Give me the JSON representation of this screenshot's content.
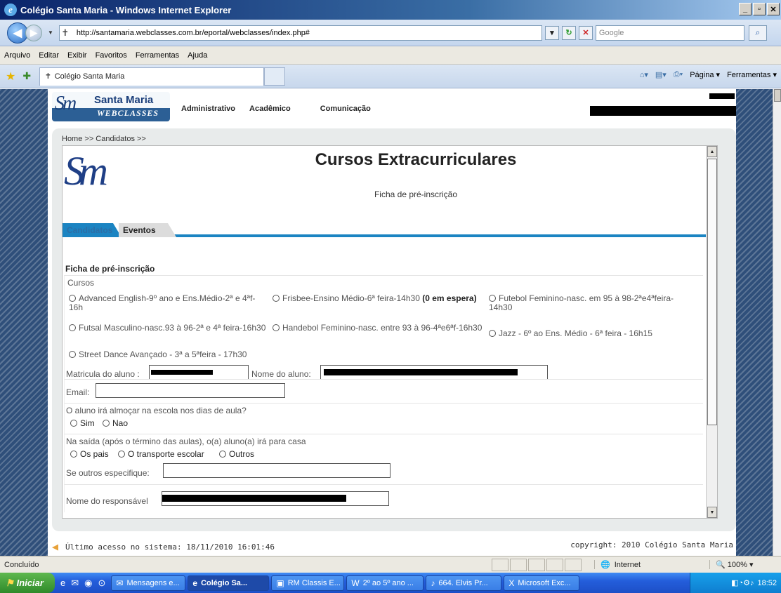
{
  "window": {
    "title": "Colégio Santa Maria - Windows Internet Explorer",
    "url": "http://santamaria.webclasses.com.br/eportal/webclasses/index.php#",
    "search_placeholder": "Google"
  },
  "menu": [
    "Arquivo",
    "Editar",
    "Exibir",
    "Favoritos",
    "Ferramentas",
    "Ajuda"
  ],
  "browser_tab": {
    "label": "Colégio Santa Maria"
  },
  "command_bar": {
    "page": "Página ▾",
    "tools": "Ferramentas ▾"
  },
  "site": {
    "logo_name": "Santa Maria",
    "logo_web": "WEBCLASSES",
    "nav": [
      "Administrativo",
      "Acadêmico",
      "Comunicação"
    ],
    "breadcrumb": "Home >> Candidatos >>",
    "title": "Cursos Extracurriculares",
    "subtitle": "Ficha de pré-inscrição",
    "tabs": [
      "Candidatos",
      "Eventos"
    ]
  },
  "form": {
    "heading": "Ficha de pré-inscrição",
    "courses_label": "Cursos",
    "courses": [
      "Advanced English-9º ano e Ens.Médio-2ª e 4ªf-16h",
      "Frisbee-Ensino Médio-6ª feira-14h30",
      "Futebol Feminino-nasc. em 95 à 98-2ªe4ªfeira-14h30",
      "Futsal Masculino-nasc.93 à 96-2ª e 4ª feira-16h30",
      "Handebol Feminino-nasc. entre 93 à 96-4ªe6ªf-16h30",
      "Jazz - 6º ao Ens. Médio - 6ª feira - 16h15",
      "Street Dance Avançado - 3ª a 5ªfeira - 17h30"
    ],
    "frisbee_note": "(0 em espera)",
    "matricula_label": "Matricula do aluno :",
    "nome_label": "Nome do aluno:",
    "email_label": "Email:",
    "lunch_question": "O aluno irá almoçar na escola nos dias de aula?",
    "lunch_options": [
      "Sim",
      "Nao"
    ],
    "exit_question": "Na saída (após o término das aulas), o(a) aluno(a) irá para casa",
    "exit_options": [
      "Os pais",
      "O transporte escolar",
      "Outros"
    ],
    "other_label": "Se outros especifique:",
    "guardian_label": "Nome do responsável"
  },
  "footer": {
    "last_access": "Último acesso no sistema: 18/11/2010 16:01:46",
    "copyright": "copyright: 2010 Colégio Santa Maria"
  },
  "status": {
    "text": "Concluído",
    "zone": "Internet",
    "zoom": "100%"
  },
  "taskbar": {
    "start": "Iniciar",
    "tasks": [
      "Mensagens e...",
      "Colégio Sa...",
      "RM Classis E...",
      "2º ao 5º ano ...",
      "664. Elvis Pr...",
      "Microsoft Exc..."
    ],
    "clock": "18:52"
  }
}
